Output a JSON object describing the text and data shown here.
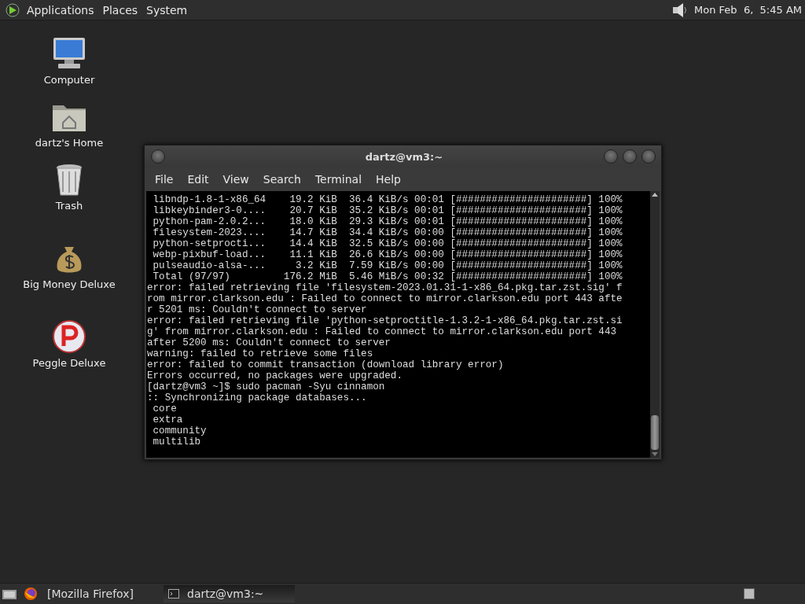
{
  "top_panel": {
    "menus": [
      "Applications",
      "Places",
      "System"
    ],
    "clock": "Mon Feb  6,  5:45 AM"
  },
  "desktop_icons": [
    {
      "label": "Computer",
      "kind": "computer"
    },
    {
      "label": "dartz's Home",
      "kind": "home"
    },
    {
      "label": "Trash",
      "kind": "trash"
    },
    {
      "label": "Big Money Deluxe",
      "kind": "money"
    },
    {
      "label": "Peggle Deluxe",
      "kind": "peggle"
    }
  ],
  "terminal": {
    "title": "dartz@vm3:~",
    "menu": [
      "File",
      "Edit",
      "View",
      "Search",
      "Terminal",
      "Help"
    ],
    "lines": [
      " libndp-1.8-1-x86_64    19.2 KiB  36.4 KiB/s 00:01 [######################] 100%",
      " libkeybinder3-0....    20.7 KiB  35.2 KiB/s 00:01 [######################] 100%",
      " python-pam-2.0.2...    18.0 KiB  29.3 KiB/s 00:01 [######################] 100%",
      " filesystem-2023....    14.7 KiB  34.4 KiB/s 00:00 [######################] 100%",
      " python-setprocti...    14.4 KiB  32.5 KiB/s 00:00 [######################] 100%",
      " webp-pixbuf-load...    11.1 KiB  26.6 KiB/s 00:00 [######################] 100%",
      " pulseaudio-alsa-...     3.2 KiB  7.59 KiB/s 00:00 [######################] 100%",
      " Total (97/97)         176.2 MiB  5.46 MiB/s 00:32 [######################] 100%",
      "error: failed retrieving file 'filesystem-2023.01.31-1-x86_64.pkg.tar.zst.sig' f",
      "rom mirror.clarkson.edu : Failed to connect to mirror.clarkson.edu port 443 afte",
      "r 5201 ms: Couldn't connect to server",
      "error: failed retrieving file 'python-setproctitle-1.3.2-1-x86_64.pkg.tar.zst.si",
      "g' from mirror.clarkson.edu : Failed to connect to mirror.clarkson.edu port 443",
      "after 5200 ms: Couldn't connect to server",
      "warning: failed to retrieve some files",
      "error: failed to commit transaction (download library error)",
      "Errors occurred, no packages were upgraded.",
      "[dartz@vm3 ~]$ sudo pacman -Syu cinnamon",
      ":: Synchronizing package databases...",
      " core",
      " extra",
      " community",
      " multilib"
    ]
  },
  "taskbar": {
    "tasks": [
      {
        "label": "[Mozilla Firefox]",
        "kind": "firefox",
        "selected": false
      },
      {
        "label": "dartz@vm3:~",
        "kind": "terminal",
        "selected": true
      }
    ]
  }
}
